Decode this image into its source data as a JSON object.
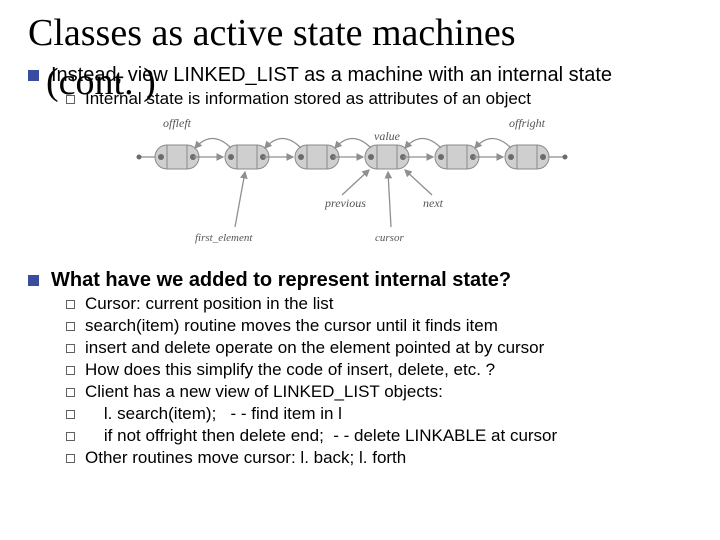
{
  "title": "Classes as active state machines",
  "cont_overlay": "(cont. )",
  "section1": {
    "point": "Instead, view LINKED_LIST as a machine with an internal state",
    "sub": "Internal state is information stored as attributes of an object"
  },
  "diagram": {
    "offleft": "offleft",
    "offright": "offright",
    "value": "value",
    "previous": "previous",
    "next": "next",
    "first_element": "first_element",
    "cursor": "cursor"
  },
  "section2": {
    "heading": "What have we added to represent internal state?",
    "items": [
      "Cursor: current position in the list",
      "search(item) routine moves the cursor until it finds item",
      "insert and delete operate on the element pointed at by cursor",
      "How does this simplify the code of insert, delete, etc. ?",
      "Client has a new view of LINKED_LIST objects:",
      "    l. search(item);   - - find item in l",
      "    if not offright then delete end;  - - delete LINKABLE at cursor",
      "Other routines move cursor: l. back; l. forth"
    ]
  }
}
